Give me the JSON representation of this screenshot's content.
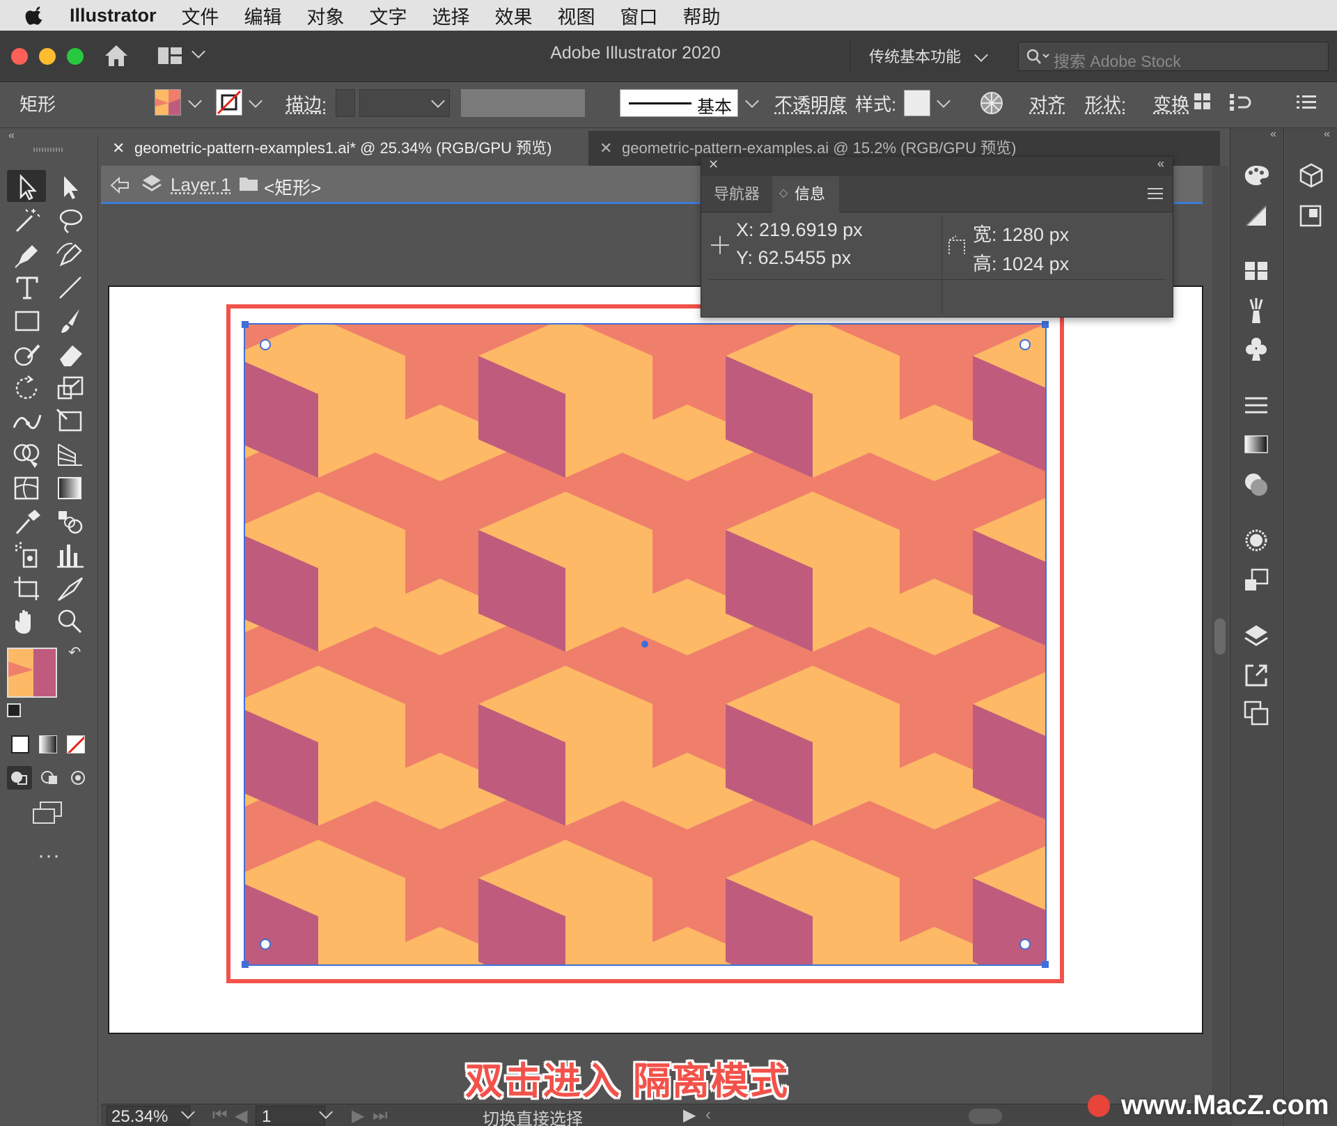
{
  "menubar": {
    "app": "Illustrator",
    "items": [
      "文件",
      "编辑",
      "对象",
      "文字",
      "选择",
      "效果",
      "视图",
      "窗口",
      "帮助"
    ]
  },
  "appbar": {
    "title": "Adobe Illustrator 2020",
    "workspace": "传统基本功能",
    "search_placeholder": "搜索 Adobe Stock"
  },
  "controlbar": {
    "object_type": "矩形",
    "stroke_label": "描边:",
    "brush_label": "基本",
    "opacity_label": "不透明度",
    "style_label": "样式:",
    "align_label": "对齐",
    "shape_label": "形状:",
    "transform_label": "变换"
  },
  "tabs": [
    {
      "label": "geometric-pattern-examples1.ai* @ 25.34% (RGB/GPU 预览)",
      "active": true
    },
    {
      "label": "geometric-pattern-examples.ai @ 15.2% (RGB/GPU 预览)",
      "active": false
    }
  ],
  "breadcrumb": {
    "layer": "Layer 1",
    "object": "<矩形>"
  },
  "info_panel": {
    "tabs": [
      "导航器",
      "信息"
    ],
    "active_tab": "信息",
    "x": "X:  219.6919 px",
    "y": "Y:  62.5455 px",
    "w": "宽:  1280 px",
    "h": "高:  1024 px"
  },
  "statusbar": {
    "zoom": "25.34%",
    "artboard": "1",
    "tool_hint": "切换直接选择"
  },
  "caption": "双击进入 隔离模式",
  "watermark": "www.MacZ.com",
  "colors": {
    "pattern_orange": "#fdb966",
    "pattern_coral": "#ef7f6b",
    "pattern_plum": "#bf5c7e",
    "highlight_red": "#f2524a",
    "selection_blue": "#3f6fd8"
  }
}
